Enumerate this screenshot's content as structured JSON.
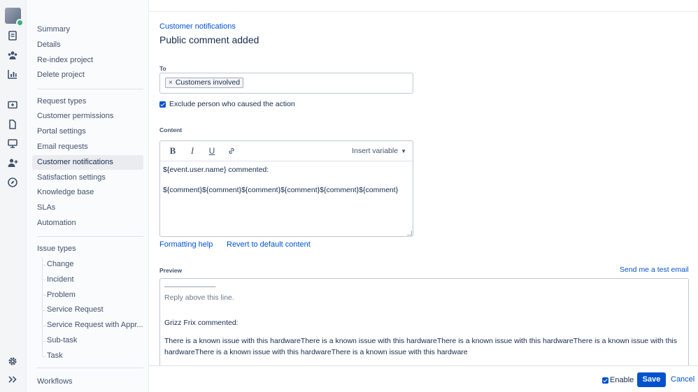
{
  "rail": {
    "icons": [
      "avatar-icon",
      "document-icon",
      "people-icon",
      "chart-icon",
      "add-queue-icon",
      "page-icon",
      "monitor-icon",
      "add-person-icon",
      "compass-icon",
      "gear-icon",
      "expand-icon"
    ]
  },
  "sidebar": {
    "group1": [
      "Summary",
      "Details",
      "Re-index project",
      "Delete project"
    ],
    "group2": [
      "Request types",
      "Customer permissions",
      "Portal settings",
      "Email requests",
      "Customer notifications",
      "Satisfaction settings",
      "Knowledge base",
      "SLAs",
      "Automation"
    ],
    "issue_types_label": "Issue types",
    "issue_types": [
      "Change",
      "Incident",
      "Problem",
      "Service Request",
      "Service Request with Appr...",
      "Sub-task",
      "Task"
    ],
    "workflows": "Workflows",
    "active": "Customer notifications"
  },
  "page": {
    "breadcrumb": "Customer notifications",
    "title": "Public comment added"
  },
  "form": {
    "to_label": "To",
    "to_tag": "Customers involved",
    "exclude_label": "Exclude person who caused the action",
    "exclude_checked": true,
    "content_label": "Content",
    "insert_variable": "Insert variable",
    "content_line1": "${event.user.name} commented:",
    "content_line2": "${comment}${comment}${comment}${comment}${comment}${comment}",
    "formatting_help": "Formatting help",
    "revert": "Revert to default content",
    "preview_label": "Preview",
    "send_test": "Send me a test email"
  },
  "preview": {
    "rule": "———————",
    "reply_above": "Reply above this line.",
    "commented": "Grizz Frix commented:",
    "body": "There is a known issue with this hardwareThere is a known issue with this hardwareThere is a known issue with this hardwareThere is a known issue with this hardwareThere is a known issue with this hardwareThere is a known issue with this hardware"
  },
  "footer": {
    "enable": "Enable",
    "enable_checked": true,
    "save": "Save",
    "cancel": "Cancel"
  },
  "colors": {
    "accent": "#0052cc",
    "text": "#172b4d",
    "sidebar_bg": "#fafbfc"
  }
}
